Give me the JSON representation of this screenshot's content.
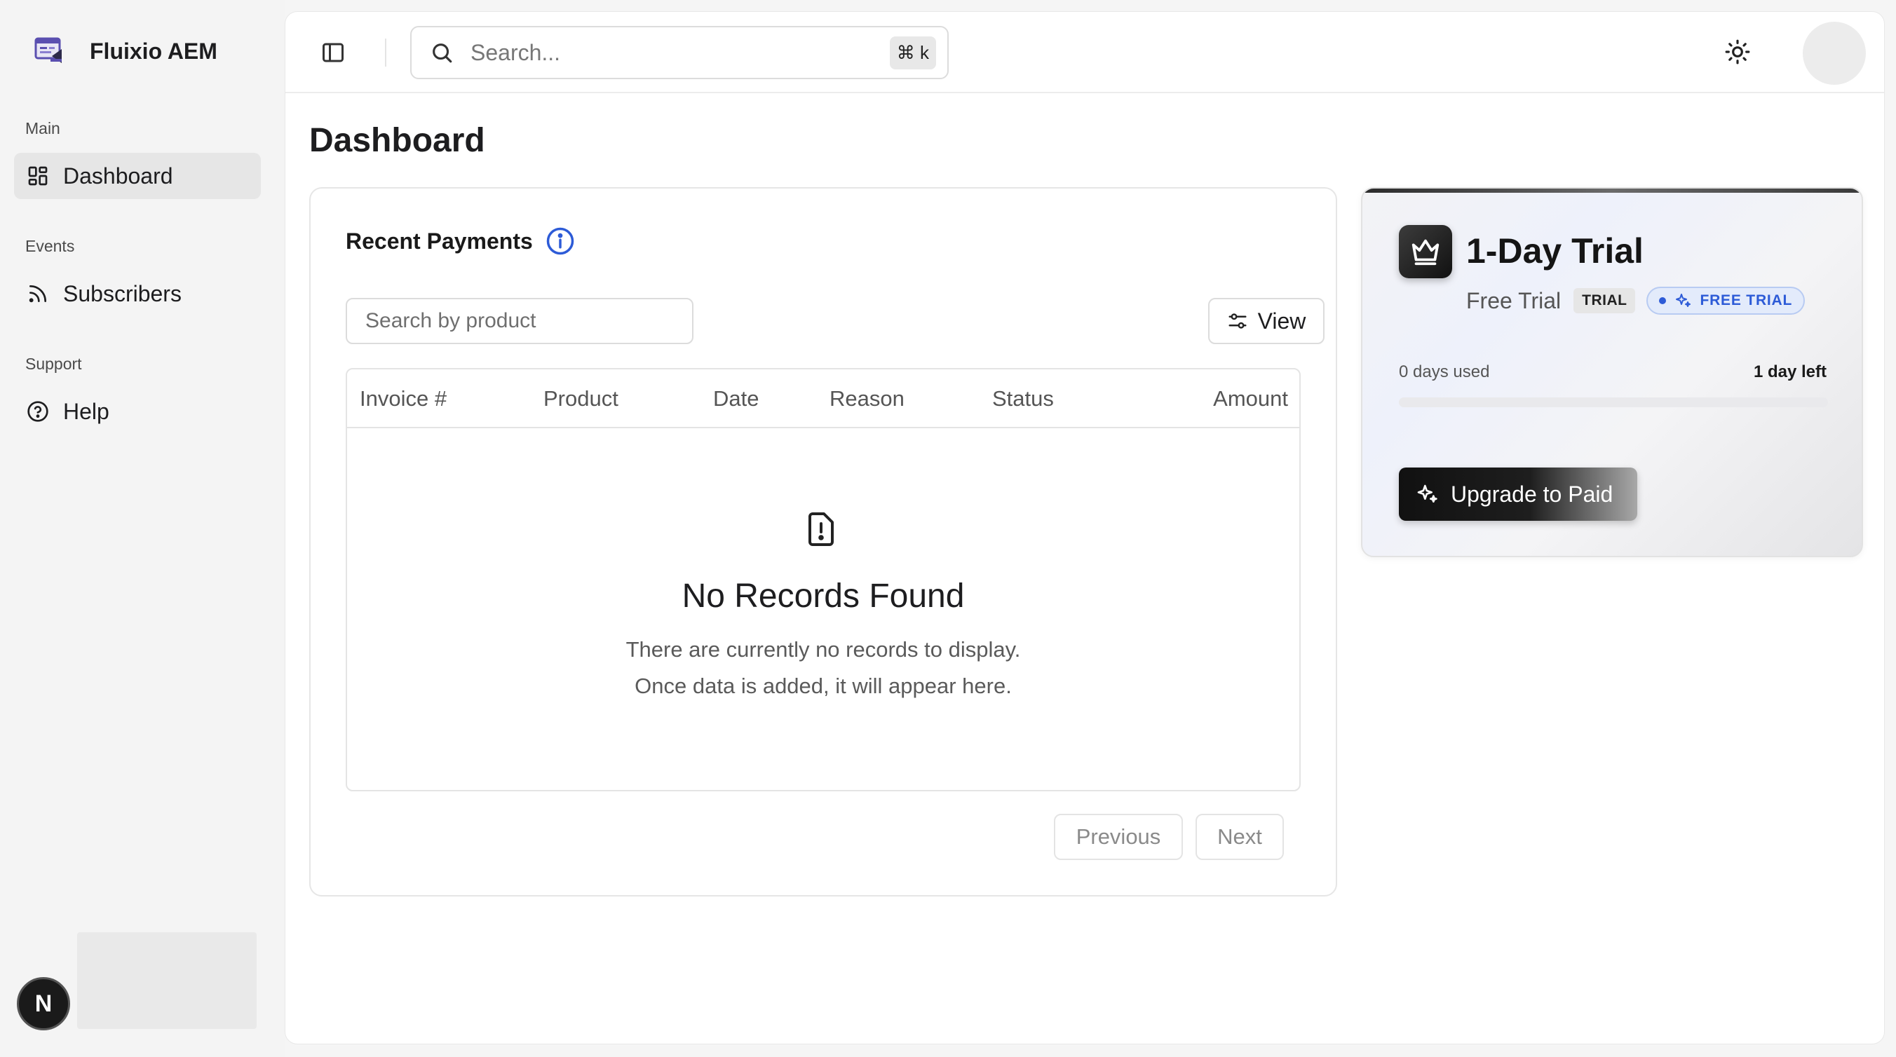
{
  "brand": {
    "name": "Fluixio AEM"
  },
  "sidebar": {
    "groups": [
      {
        "label": "Main",
        "items": [
          {
            "label": "Dashboard",
            "icon": "dashboard-icon",
            "active": true
          }
        ]
      },
      {
        "label": "Events",
        "items": [
          {
            "label": "Subscribers",
            "icon": "rss-icon"
          }
        ]
      },
      {
        "label": "Support",
        "items": [
          {
            "label": "Help",
            "icon": "help-circle-icon"
          }
        ]
      }
    ],
    "user_initial": "N"
  },
  "topbar": {
    "search_placeholder": "Search...",
    "shortcut": "⌘ k"
  },
  "page": {
    "title": "Dashboard"
  },
  "payments": {
    "title": "Recent Payments",
    "search_placeholder": "Search by product",
    "view_label": "View",
    "columns": [
      "Invoice #",
      "Product",
      "Date",
      "Reason",
      "Status",
      "Amount"
    ],
    "empty_title": "No Records Found",
    "empty_line1": "There are currently no records to display.",
    "empty_line2": "Once data is added, it will appear here.",
    "prev_label": "Previous",
    "next_label": "Next"
  },
  "trial": {
    "title": "1-Day Trial",
    "subtitle": "Free Trial",
    "badge": "TRIAL",
    "badge2": "FREE TRIAL",
    "days_used": "0 days used",
    "days_left": "1 day left",
    "progress_fraction": 0,
    "upgrade_label": "Upgrade to Paid"
  },
  "colors": {
    "accent_blue": "#2d5bd7",
    "dark": "#1a1a1a"
  }
}
